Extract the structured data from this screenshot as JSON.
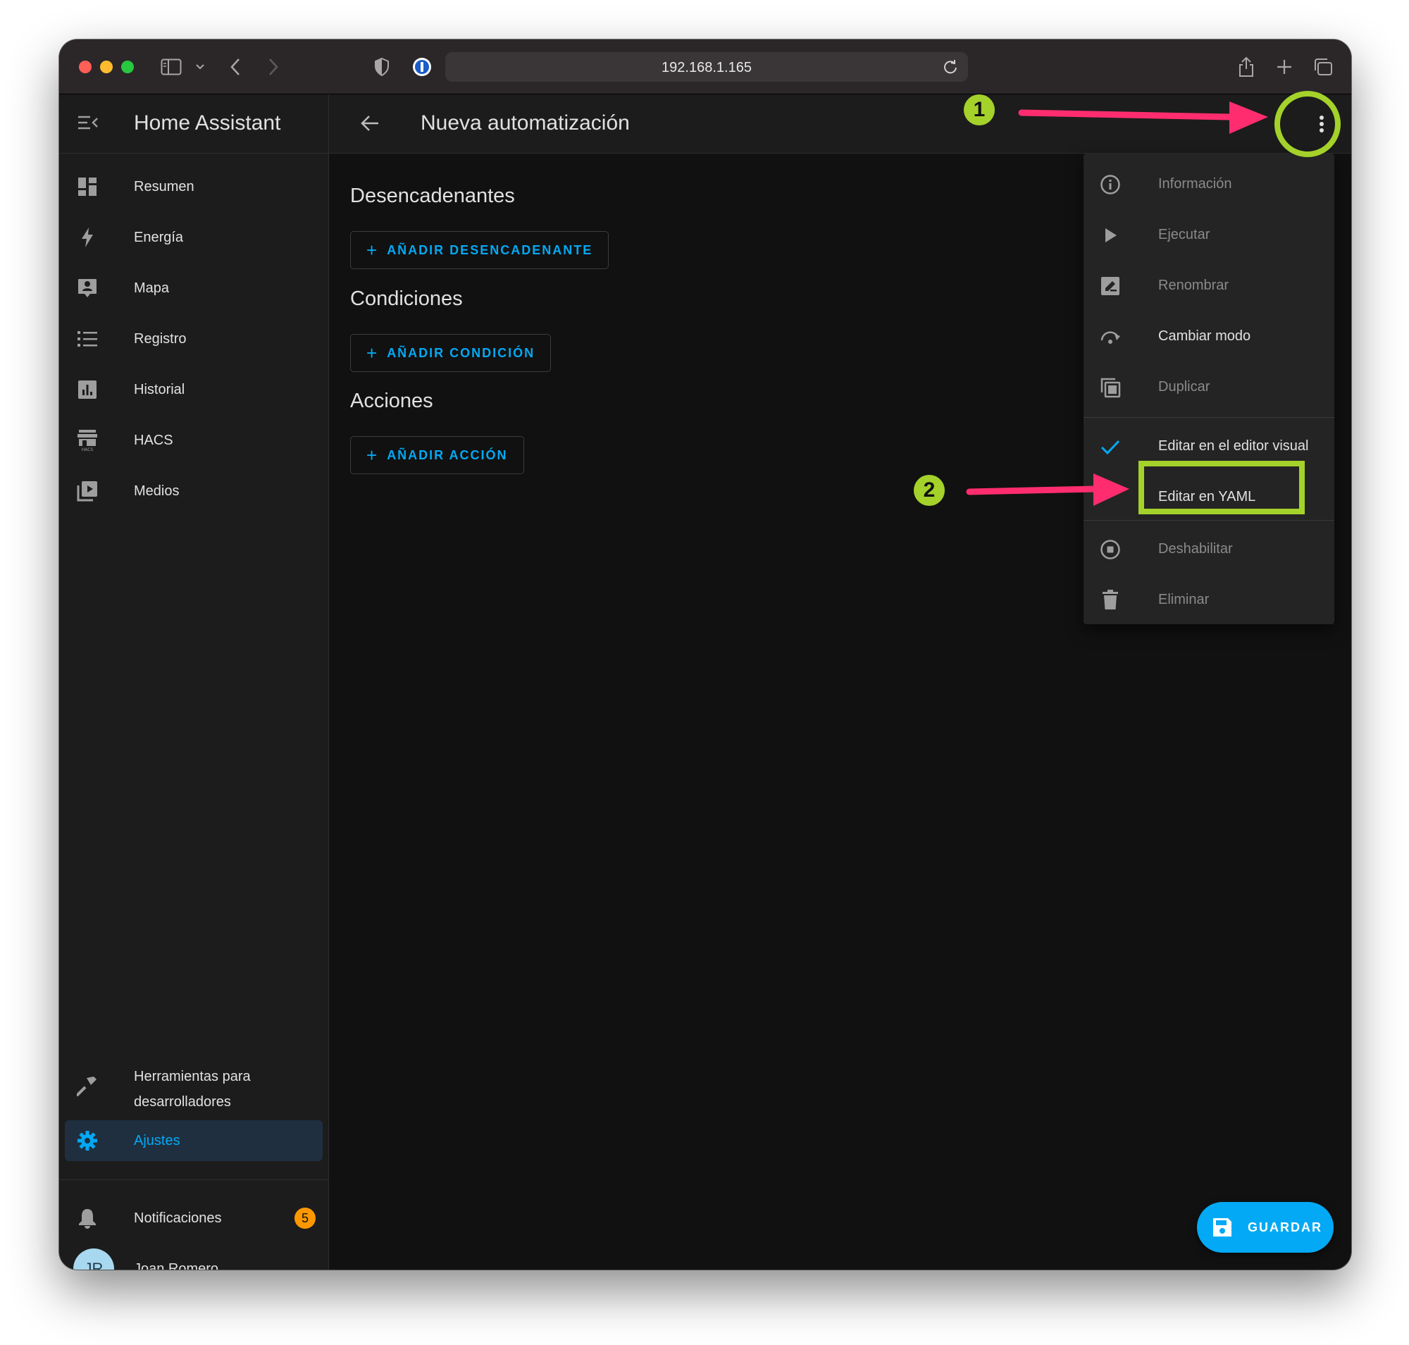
{
  "browser": {
    "url": "192.168.1.165"
  },
  "sidebar": {
    "title": "Home Assistant",
    "items": [
      {
        "label": "Resumen",
        "icon": "dashboard-icon"
      },
      {
        "label": "Energía",
        "icon": "lightning-icon"
      },
      {
        "label": "Mapa",
        "icon": "map-person-icon"
      },
      {
        "label": "Registro",
        "icon": "list-icon"
      },
      {
        "label": "Historial",
        "icon": "chart-icon"
      },
      {
        "label": "HACS",
        "icon": "hacs-icon"
      },
      {
        "label": "Medios",
        "icon": "media-icon"
      }
    ],
    "developer_tools_line1": "Herramientas para",
    "developer_tools_line2": "desarrolladores",
    "settings": "Ajustes",
    "notifications": "Notificaciones",
    "notifications_count": "5",
    "user_initials": "JR",
    "user_name": "Joan Romero"
  },
  "main": {
    "title": "Nueva automatización",
    "sections": [
      {
        "title": "Desencadenantes",
        "button": "AÑADIR DESENCADENANTE"
      },
      {
        "title": "Condiciones",
        "button": "AÑADIR CONDICIÓN"
      },
      {
        "title": "Acciones",
        "button": "AÑADIR ACCIÓN"
      }
    ],
    "save_label": "GUARDAR"
  },
  "menu": {
    "items": [
      {
        "label": "Información",
        "icon": "info-icon",
        "enabled": false
      },
      {
        "label": "Ejecutar",
        "icon": "play-icon",
        "enabled": false
      },
      {
        "label": "Renombrar",
        "icon": "rename-icon",
        "enabled": false
      },
      {
        "label": "Cambiar modo",
        "icon": "mode-icon",
        "enabled": true
      },
      {
        "label": "Duplicar",
        "icon": "duplicate-icon",
        "enabled": false
      },
      {
        "label": "Editar en el editor visual",
        "icon": "check-icon",
        "enabled": true,
        "checked": true
      },
      {
        "label": "Editar en YAML",
        "icon": "",
        "enabled": true
      },
      {
        "label": "Deshabilitar",
        "icon": "stop-circle-icon",
        "enabled": false
      },
      {
        "label": "Eliminar",
        "icon": "trash-icon",
        "enabled": false
      }
    ]
  },
  "annotations": {
    "step1": "1",
    "step2": "2",
    "highlight_color": "#a4d22a",
    "arrow_color": "#ff2d6f"
  },
  "colors": {
    "accent": "#03a9f4",
    "badge": "#ff9800"
  }
}
